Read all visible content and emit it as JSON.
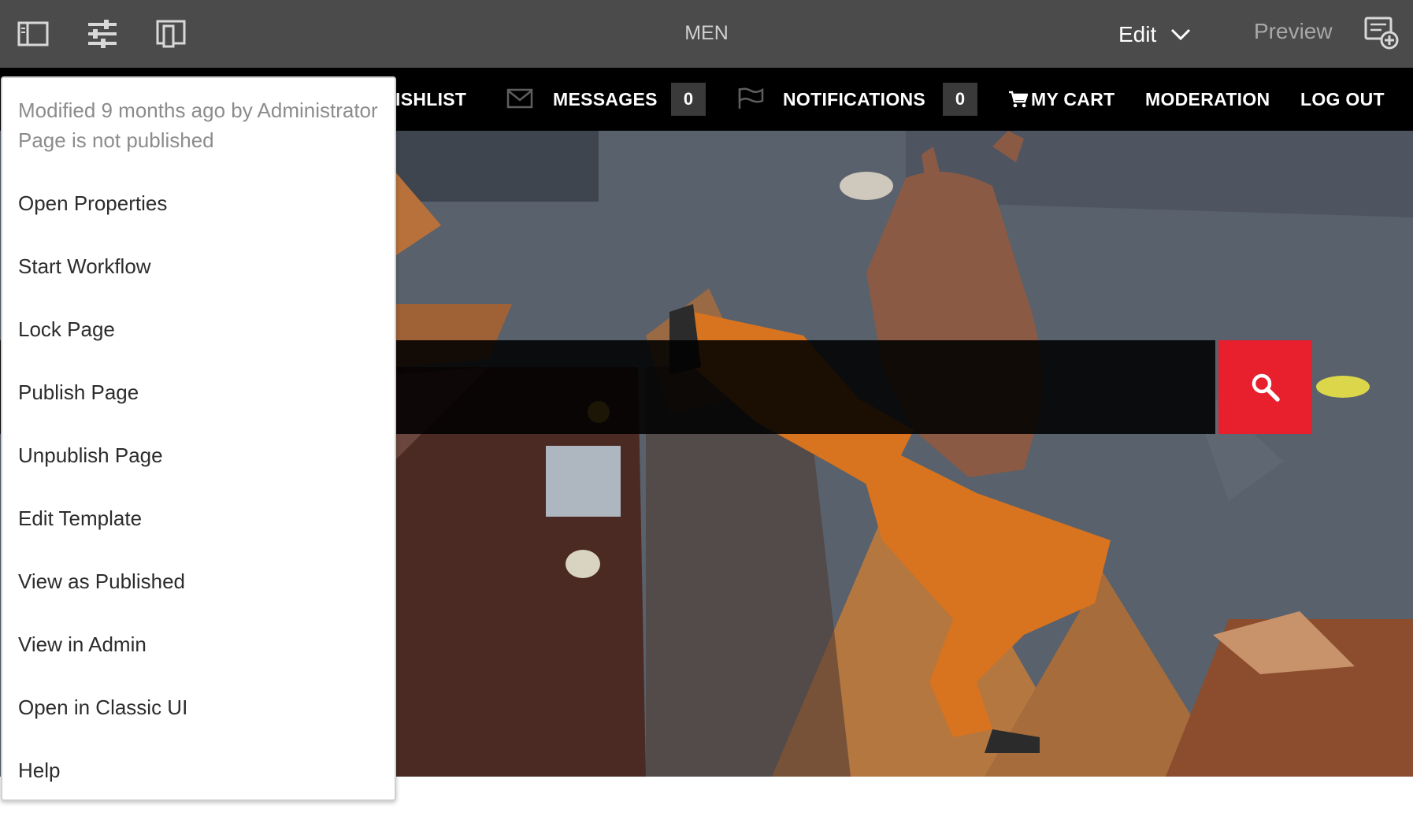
{
  "toolbar": {
    "title": "MEN",
    "mode": "Edit",
    "preview": "Preview",
    "icons": [
      "side-panel-icon",
      "page-information-icon",
      "emulator-icon",
      "annotation-icon",
      "chevron-down-icon"
    ]
  },
  "site_nav": {
    "wishlist": "WISHLIST",
    "messages": "MESSAGES",
    "messages_count": "0",
    "notifications": "NOTIFICATIONS",
    "notifications_count": "0",
    "cart": "MY CART",
    "moderation": "MODERATION",
    "logout": "LOG OUT",
    "icons": [
      "envelope-icon",
      "flag-icon",
      "cart-icon"
    ]
  },
  "search": {
    "icon": "search-icon",
    "button_color": "#e8202e"
  },
  "page_menu": {
    "modified": "Modified 9 months ago by Administrator",
    "status": "Page is not published",
    "items": [
      "Open Properties",
      "Start Workflow",
      "Lock Page",
      "Publish Page",
      "Unpublish Page",
      "Edit Template",
      "View as Published",
      "View in Admin",
      "Open in Classic UI",
      "Help"
    ]
  },
  "colors": {
    "toolbar_bg": "#4b4b4b",
    "nav_bg": "#000000",
    "accent_red": "#e8202e"
  }
}
